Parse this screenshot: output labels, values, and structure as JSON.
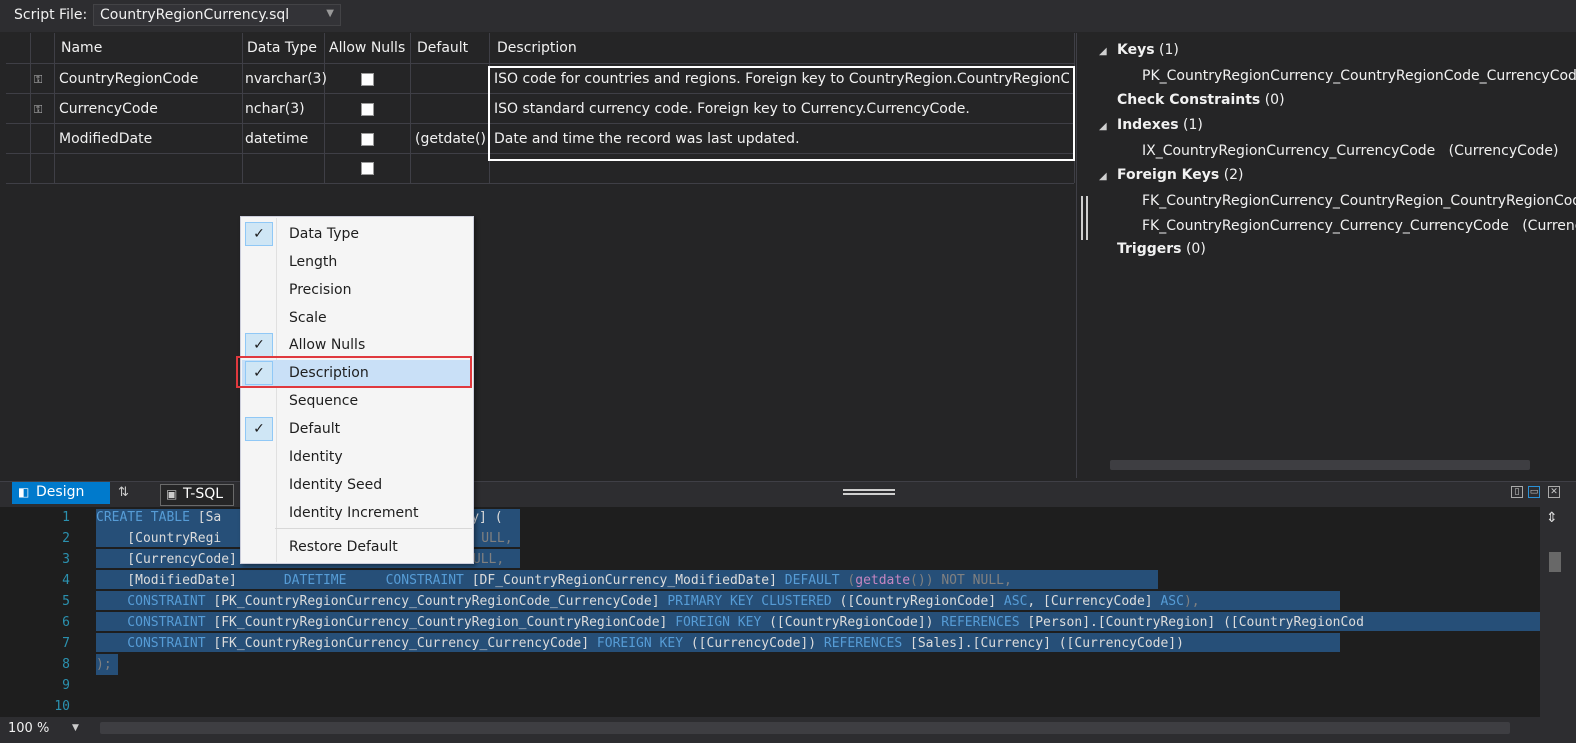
{
  "toolbar": {
    "script_file_label": "Script File:",
    "script_file_value": "CountryRegionCurrency.sql"
  },
  "grid": {
    "columns": [
      "Name",
      "Data Type",
      "Allow Nulls",
      "Default",
      "Description"
    ],
    "rows": [
      {
        "name": "CountryRegionCode",
        "type": "nvarchar(3)",
        "default": "",
        "description": "ISO code for countries and regions. Foreign key to CountryRegion.CountryRegionCode.",
        "is_key": true
      },
      {
        "name": "CurrencyCode",
        "type": "nchar(3)",
        "default": "",
        "description": "ISO standard currency code. Foreign key to Currency.CurrencyCode.",
        "is_key": true
      },
      {
        "name": "ModifiedDate",
        "type": "datetime",
        "default": "(getdate())",
        "description": "Date and time the record was last updated.",
        "is_key": false
      },
      {
        "name": "",
        "type": "",
        "default": "",
        "description": "",
        "is_key": false
      }
    ]
  },
  "tree": {
    "keys": {
      "label": "Keys",
      "count": "(1)",
      "items": [
        "PK_CountryRegionCurrency_CountryRegionCode_CurrencyCode"
      ]
    },
    "check_constraints": {
      "label": "Check Constraints",
      "count": "(0)"
    },
    "indexes": {
      "label": "Indexes",
      "count": "(1)",
      "items": [
        {
          "name": "IX_CountryRegionCurrency_CurrencyCode",
          "cols": "(CurrencyCode)"
        }
      ]
    },
    "foreign_keys": {
      "label": "Foreign Keys",
      "count": "(2)",
      "items": [
        {
          "name": "FK_CountryRegionCurrency_CountryRegion_CountryRegionCode",
          "cols": ""
        },
        {
          "name": "FK_CountryRegionCurrency_Currency_CurrencyCode",
          "cols": "(CurrencyCo"
        }
      ]
    },
    "triggers": {
      "label": "Triggers",
      "count": "(0)"
    }
  },
  "tabs": {
    "design": "Design",
    "tsql": "T-SQL"
  },
  "context_menu": {
    "items": [
      {
        "label": "Data Type",
        "checked": true
      },
      {
        "label": "Length",
        "checked": false
      },
      {
        "label": "Precision",
        "checked": false
      },
      {
        "label": "Scale",
        "checked": false
      },
      {
        "label": "Allow Nulls",
        "checked": true
      },
      {
        "label": "Description",
        "checked": true
      },
      {
        "label": "Sequence",
        "checked": false
      },
      {
        "label": "Default",
        "checked": true
      },
      {
        "label": "Identity",
        "checked": false
      },
      {
        "label": "Identity Seed",
        "checked": false
      },
      {
        "label": "Identity Increment",
        "checked": false
      }
    ],
    "restore": "Restore Default",
    "check_glyph": "✓"
  },
  "code": {
    "line_numbers": [
      "1",
      "2",
      "3",
      "4",
      "5",
      "6",
      "7",
      "8",
      "9",
      "10"
    ],
    "l1a": "CREATE TABLE",
    "l1b": " [Sa",
    "l1c": "y] (",
    "l2a": "    [CountryRegi",
    "l2b": "ULL,",
    "l3a": "    [CurrencyCode]",
    "l3b": "ULL,",
    "l4a": "    [ModifiedDate]      ",
    "l4b": "DATETIME",
    "l4c": "     ",
    "l4d": "CONSTRAINT",
    "l4e": " [DF_CountryRegionCurrency_ModifiedDate] ",
    "l4f": "DEFAULT",
    "l4g": " (",
    "l4h": "getdate",
    "l4i": "()) ",
    "l4j": "NOT NULL",
    "l4k": ",",
    "l5a": "    CONSTRAINT",
    "l5b": " [PK_CountryRegionCurrency_CountryRegionCode_CurrencyCode] ",
    "l5c": "PRIMARY KEY CLUSTERED",
    "l5d": " ([CountryRegionCode] ",
    "l5e": "ASC",
    "l5f": ", [CurrencyCode] ",
    "l5g": "ASC",
    "l5h": "),",
    "l6a": "    CONSTRAINT",
    "l6b": " [FK_CountryRegionCurrency_CountryRegion_CountryRegionCode] ",
    "l6c": "FOREIGN KEY",
    "l6d": " ([CountryRegionCode]) ",
    "l6e": "REFERENCES",
    "l6f": " [Person].[CountryRegion] ([CountryRegionCod",
    "l7a": "    CONSTRAINT",
    "l7b": " [FK_CountryRegionCurrency_Currency_CurrencyCode] ",
    "l7c": "FOREIGN KEY",
    "l7d": " ([CurrencyCode]) ",
    "l7e": "REFERENCES",
    "l7f": " [Sales].[Currency] ([CurrencyCode])",
    "l8a": ");"
  },
  "status": {
    "zoom": "100 %"
  }
}
